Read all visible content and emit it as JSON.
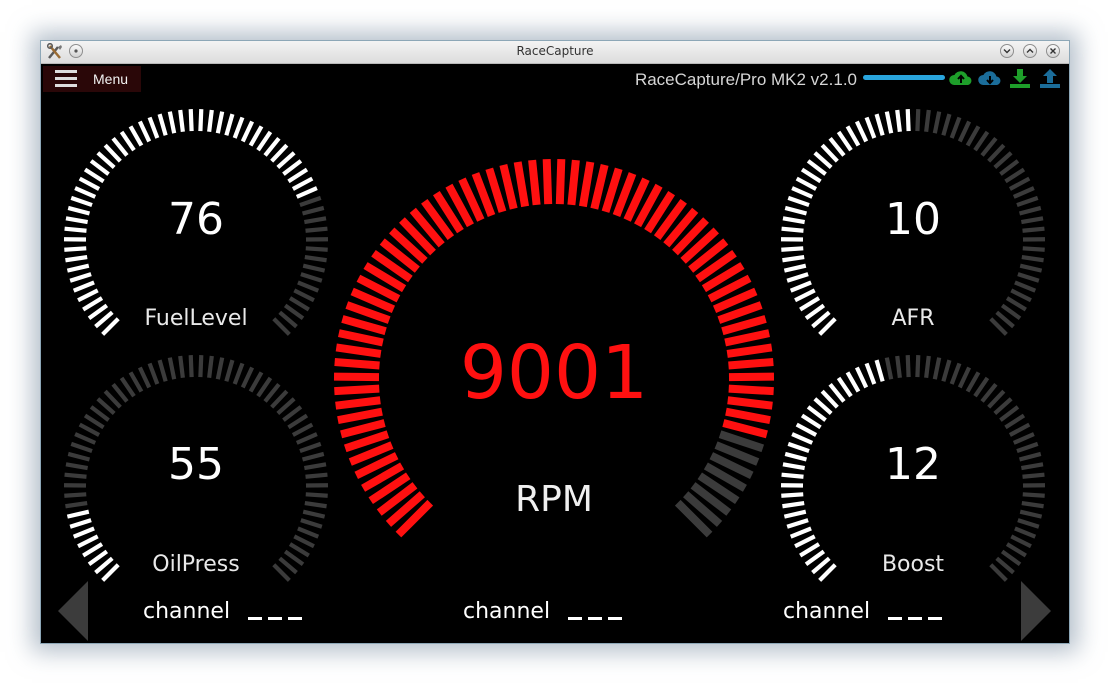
{
  "window": {
    "title": "RaceCapture"
  },
  "header": {
    "menu_label": "Menu",
    "device_label": "RaceCapture/Pro MK2 v2.1.0",
    "icons": [
      "cloud-upload-icon",
      "cloud-download-icon",
      "download-icon",
      "upload-icon"
    ],
    "connection_color": "#29a5dd"
  },
  "gauges": {
    "fuel": {
      "label": "FuelLevel",
      "value": "76",
      "level": 0.76
    },
    "oil": {
      "label": "OilPress",
      "value": "55",
      "level": 0.12
    },
    "afr": {
      "label": "AFR",
      "value": "10",
      "level": 0.5
    },
    "boost": {
      "label": "Boost",
      "value": "12",
      "level": 0.45
    },
    "rpm": {
      "label": "RPM",
      "value": "9001",
      "level": 0.9,
      "color": "#ff1010"
    }
  },
  "channels": [
    {
      "label": "channel",
      "value": "– – –"
    },
    {
      "label": "channel",
      "value": "– – –"
    },
    {
      "label": "channel",
      "value": "– – –"
    }
  ],
  "colors": {
    "active": "#ffffff",
    "inactive": "#3b3b3b",
    "rpm_active": "#ff1010",
    "background": "#000000"
  }
}
